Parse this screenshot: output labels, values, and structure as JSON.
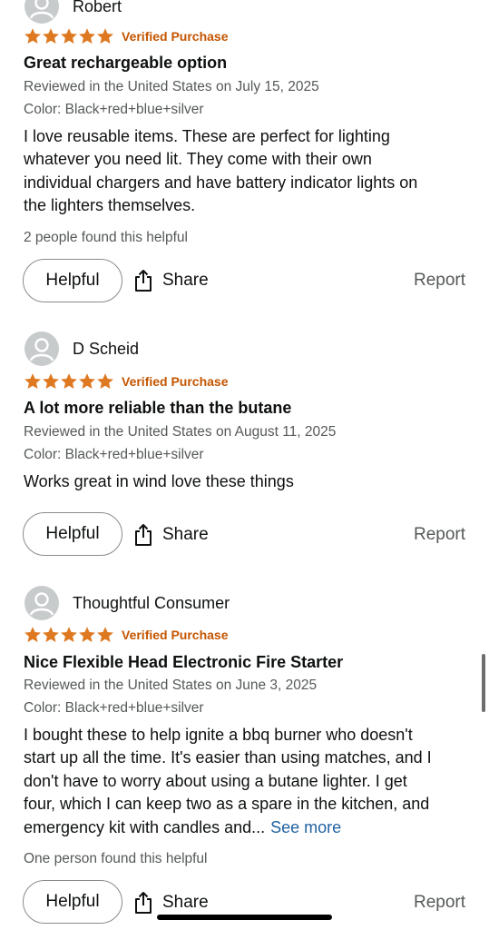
{
  "colors": {
    "star": "#de7921",
    "verified": "#c45500",
    "link": "#2162a1",
    "secondary_text": "#565959"
  },
  "reviews": [
    {
      "reviewer": "Robert",
      "rating": 5,
      "badge": "Verified Purchase",
      "title": "Great rechargeable option",
      "reviewed_in": "Reviewed in the United States on July 15, 2025",
      "color": "Color: Black+red+blue+silver",
      "body_lines": [
        "I love reusable items. These are perfect for lighting",
        "whatever you need lit. They come with their own",
        "individual chargers and have battery indicator lights on",
        "the lighters themselves."
      ],
      "helpful_count": "2 people found this helpful",
      "helpful_label": "Helpful",
      "share_label": "Share",
      "report_label": "Report"
    },
    {
      "reviewer": "D Scheid",
      "rating": 5,
      "badge": "Verified Purchase",
      "title": "A lot more reliable than the butane",
      "reviewed_in": "Reviewed in the United States on August 11, 2025",
      "color": "Color: Black+red+blue+silver",
      "body_lines": [
        "Works great in wind love these things"
      ],
      "helpful_label": "Helpful",
      "share_label": "Share",
      "report_label": "Report"
    },
    {
      "reviewer": "Thoughtful Consumer",
      "rating": 5,
      "badge": "Verified Purchase",
      "title": "Nice Flexible Head Electronic Fire Starter",
      "reviewed_in": "Reviewed in the United States on June 3, 2025",
      "color": "Color: Black+red+blue+silver",
      "body_lines": [
        "I bought these to help ignite a bbq burner who doesn't",
        "start up all the time. It's easier than using matches, and I",
        "don't have to worry about using a butane lighter. I get",
        "four, which I can keep two as a spare in the kitchen, and",
        "emergency kit with candles and..."
      ],
      "see_more": "See more",
      "helpful_count": "One person found this helpful",
      "helpful_label": "Helpful",
      "share_label": "Share",
      "report_label": "Report"
    }
  ]
}
